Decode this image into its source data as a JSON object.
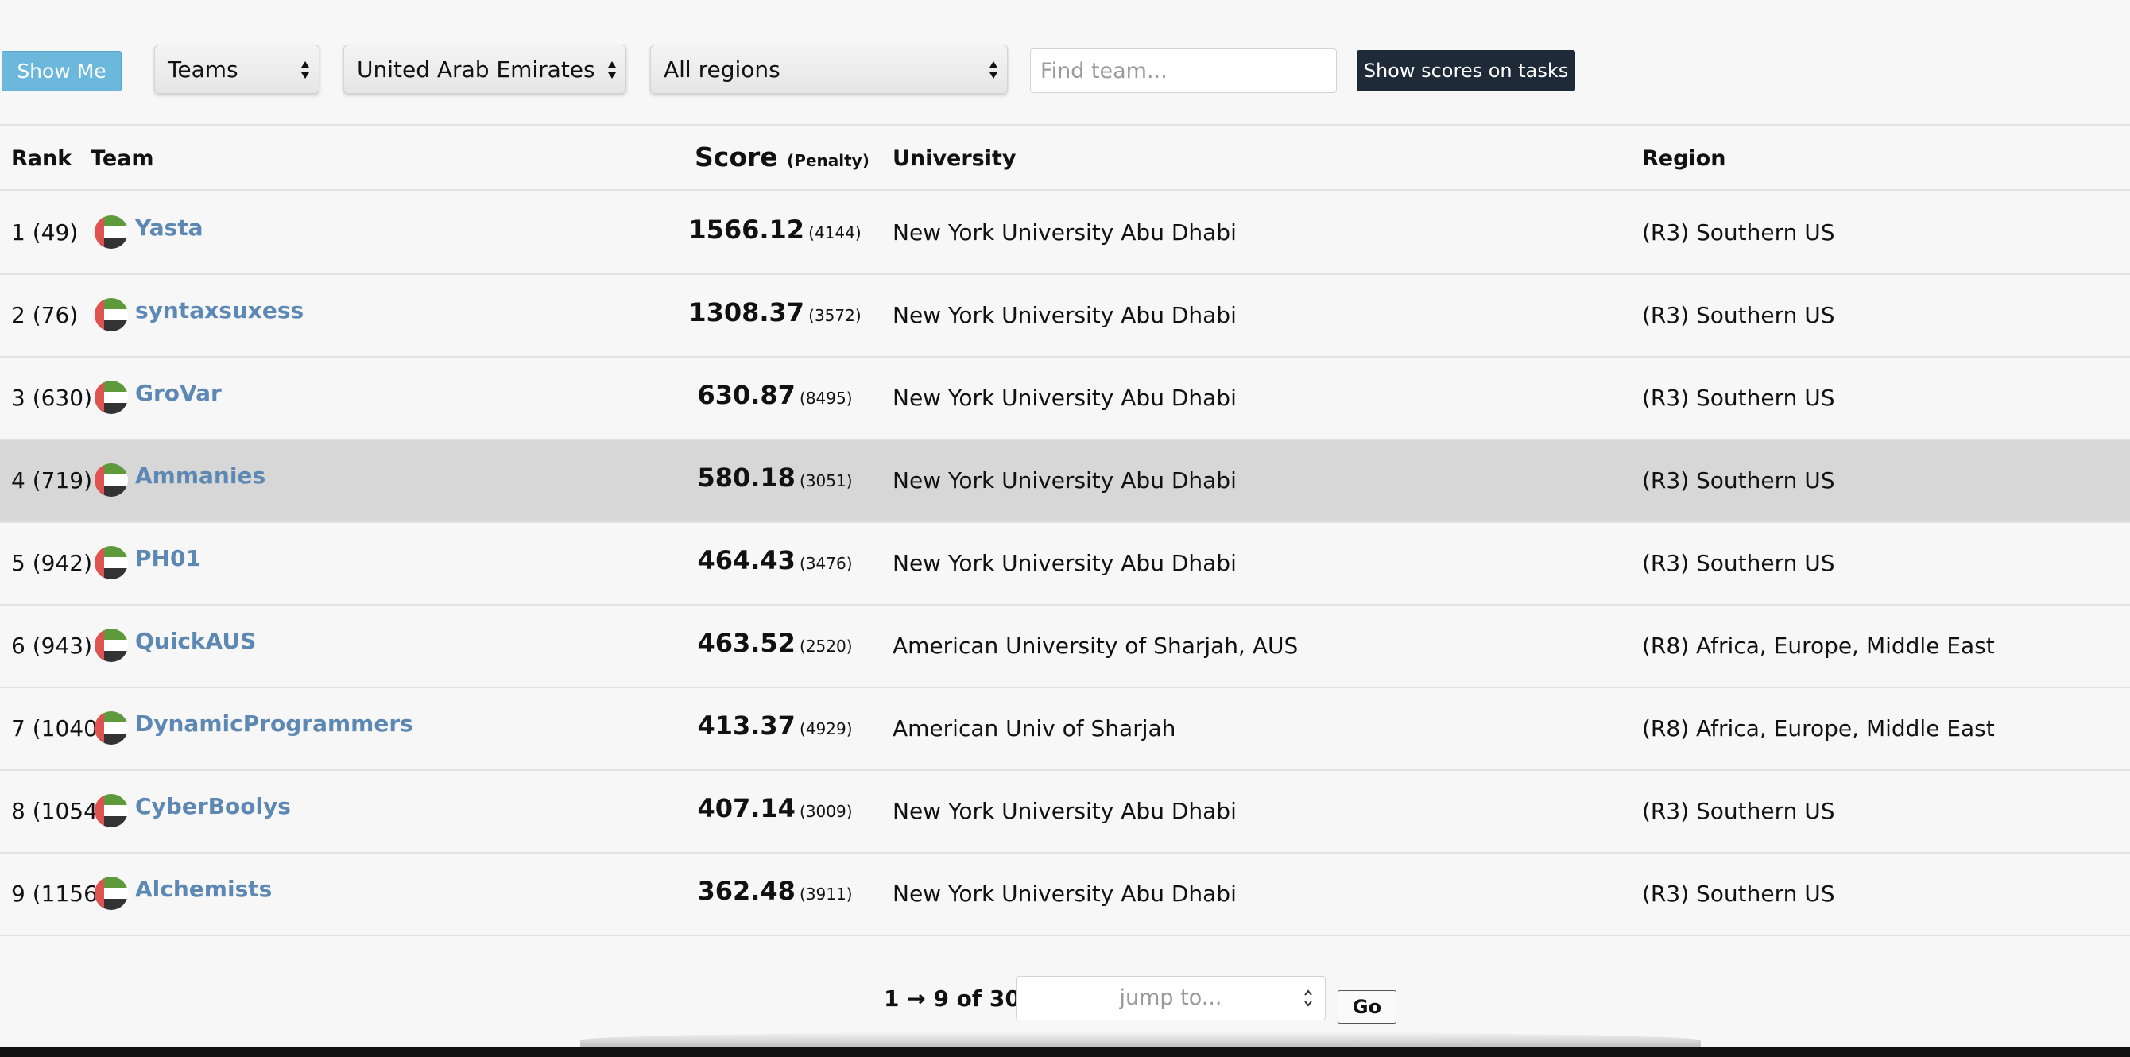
{
  "toolbar": {
    "show_me_label": "Show Me",
    "type_select": "Teams",
    "country_select": "United Arab Emirates",
    "region_select": "All regions",
    "find_placeholder": "Find team...",
    "show_scores_label": "Show scores on tasks"
  },
  "table": {
    "headers": {
      "rank": "Rank",
      "team": "Team",
      "score": "Score",
      "penalty": "(Penalty)",
      "university": "University",
      "region": "Region"
    },
    "rows": [
      {
        "rank": "1 (49)",
        "team": "Yasta",
        "score": "1566.12",
        "penalty": "(4144)",
        "university": "New York University Abu Dhabi",
        "region": "(R3) Southern US"
      },
      {
        "rank": "2 (76)",
        "team": "syntaxsuxess",
        "score": "1308.37",
        "penalty": "(3572)",
        "university": "New York University Abu Dhabi",
        "region": "(R3) Southern US"
      },
      {
        "rank": "3 (630)",
        "team": "GroVar",
        "score": "630.87",
        "penalty": "(8495)",
        "university": "New York University Abu Dhabi",
        "region": "(R3) Southern US"
      },
      {
        "rank": "4 (719)",
        "team": "Ammanies",
        "score": "580.18",
        "penalty": "(3051)",
        "university": "New York University Abu Dhabi",
        "region": "(R3) Southern US"
      },
      {
        "rank": "5 (942)",
        "team": "PH01",
        "score": "464.43",
        "penalty": "(3476)",
        "university": "New York University Abu Dhabi",
        "region": "(R3) Southern US"
      },
      {
        "rank": "6 (943)",
        "team": "QuickAUS",
        "score": "463.52",
        "penalty": "(2520)",
        "university": "American University of Sharjah, AUS",
        "region": "(R8) Africa, Europe, Middle East"
      },
      {
        "rank": "7 (1040)",
        "team": "DynamicProgrammers",
        "score": "413.37",
        "penalty": "(4929)",
        "university": "American Univ of Sharjah",
        "region": "(R8) Africa, Europe, Middle East"
      },
      {
        "rank": "8 (1054)",
        "team": "CyberBoolys",
        "score": "407.14",
        "penalty": "(3009)",
        "university": "New York University Abu Dhabi",
        "region": "(R3) Southern US"
      },
      {
        "rank": "9 (1156)",
        "team": "Alchemists",
        "score": "362.48",
        "penalty": "(3911)",
        "university": "New York University Abu Dhabi",
        "region": "(R3) Southern US"
      }
    ]
  },
  "pager": {
    "summary": "1 → 9 of 30.",
    "jump_placeholder": "jump to...",
    "go_label": "Go"
  },
  "colors": {
    "show_me_bg": "#6bb8dc",
    "scores_button_bg": "#1f2a38",
    "team_link": "#5e88b4",
    "row_highlight": "#d7d7d7",
    "flag_green": "#5c9a3c",
    "flag_red": "#e0524f",
    "flag_black": "#333333"
  }
}
